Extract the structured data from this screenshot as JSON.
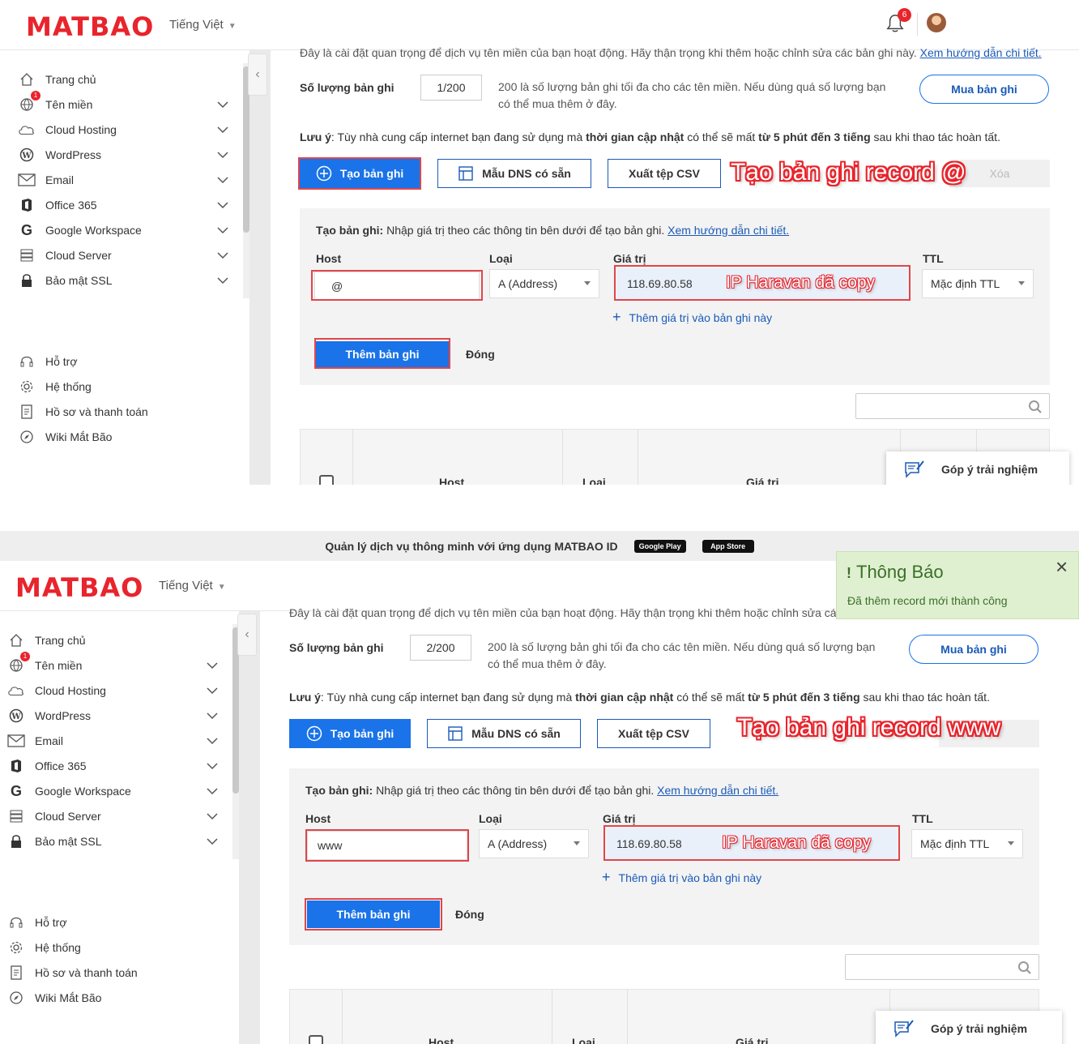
{
  "brand": {
    "logo": "MATBAO",
    "accent": "#e8242c",
    "primary": "#1a73e8"
  },
  "header": {
    "language": "Tiếng Việt",
    "notification_count": "6"
  },
  "banner": {
    "text": "Quản lý dịch vụ thông minh với ứng dụng MATBAO ID",
    "google_play": "Google Play",
    "app_store": "App Store"
  },
  "sidebar": {
    "items": [
      {
        "label": "Trang chủ",
        "icon": "home-icon"
      },
      {
        "label": "Tên miền",
        "icon": "globe-icon"
      },
      {
        "label": "Cloud Hosting",
        "icon": "cloud-icon"
      },
      {
        "label": "WordPress",
        "icon": "wordpress-icon"
      },
      {
        "label": "Email",
        "icon": "mail-icon"
      },
      {
        "label": "Office 365",
        "icon": "office-icon"
      },
      {
        "label": "Google Workspace",
        "icon": "google-icon"
      },
      {
        "label": "Cloud Server",
        "icon": "server-icon"
      },
      {
        "label": "Bảo mật SSL",
        "icon": "lock-icon"
      }
    ],
    "bottom": [
      {
        "label": "Hỗ trợ",
        "icon": "headset-icon"
      },
      {
        "label": "Hệ thống",
        "icon": "gear-icon"
      },
      {
        "label": "Hồ sơ và thanh toán",
        "icon": "document-icon"
      },
      {
        "label": "Wiki Mắt Bão",
        "icon": "compass-icon"
      }
    ],
    "domain_badge": "1"
  },
  "content": {
    "warning": "Đây là cài đặt quan trọng để dịch vụ tên miền của bạn hoạt động. Hãy thận trọng khi thêm hoặc chỉnh sửa các bản ghi này.",
    "warning_link": "Xem hướng dẫn chi tiết.",
    "record_count_label": "Số lượng bản ghi",
    "record_info_1": "200 là số lượng bản ghi tối đa cho các tên miền. Nếu dùng quá số lượng bạn",
    "record_info_2": "có thể mua thêm ở đây.",
    "buy_button": "Mua bản ghi",
    "note_label": "Lưu ý",
    "note_1": ": Tùy nhà cung cấp internet bạn đang sử dụng mà ",
    "note_b1": "thời gian cập nhật",
    "note_2": " có thể sẽ mất ",
    "note_b2": "từ 5 phút đến 3 tiếng",
    "note_3": " sau khi thao tác hoàn tất.",
    "create_button": "Tạo bản ghi",
    "dns_template_button": "Mẫu DNS có sẵn",
    "export_button": "Xuất tệp CSV",
    "delete_button": "Xóa",
    "form_title": "Tạo bản ghi:",
    "form_desc": " Nhập giá trị theo các thông tin bên dưới để tạo bản ghi. ",
    "form_link": "Xem hướng dẫn chi tiết.",
    "host_label": "Host",
    "type_label": "Loại",
    "value_label": "Giá trị",
    "ttl_label": "TTL",
    "type_value": "A (Address)",
    "ip_value": "118.69.80.58",
    "ttl_value": "Mặc định TTL",
    "add_value_link": "Thêm giá trị vào bản ghi này",
    "add_record_button": "Thêm bản ghi",
    "close_button": "Đóng",
    "table_host": "Host",
    "table_type": "Loại",
    "table_value": "Giá trị",
    "feedback": "Góp ý trải nghiệm"
  },
  "panel1": {
    "record_count": "1/200",
    "host_value": "@",
    "annotation_title": "Tạo bản ghi record @",
    "annotation_ip": "IP Haravan đã copy"
  },
  "panel2": {
    "record_count": "2/200",
    "host_value": "www",
    "annotation_title": "Tạo bản ghi record www",
    "annotation_ip": "IP Haravan đã copy",
    "toast_title": "Thông Báo",
    "toast_message": "Đã thêm record mới thành công"
  }
}
